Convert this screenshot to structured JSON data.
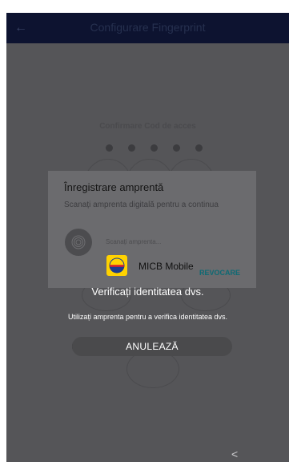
{
  "app_bar": {
    "back_icon": "arrow-left-icon",
    "title": "Configurare Fingerprint"
  },
  "pin": {
    "title": "Confirmare Cod de acces",
    "dots": 5
  },
  "dialog": {
    "title": "Înregistrare amprentă",
    "description": "Scanați amprenta digitală pentru a continua",
    "hint": "Scanați amprenta...",
    "revoke_label": "REVOCARE"
  },
  "auth_prompt": {
    "app_name": "MICB Mobile",
    "title": "Verificați identitatea dvs.",
    "subtitle": "Utilizați amprenta pentru a verifica identitatea dvs.",
    "cancel_label": "ANULEAZĂ"
  },
  "nav": {
    "back_glyph": "<"
  },
  "colors": {
    "app_bar": "#0d1330",
    "overlay": "#555558",
    "accent": "#0e6a74",
    "logo_yellow": "#ffd200",
    "logo_blue": "#1a3c8e",
    "logo_red": "#d9202a"
  }
}
